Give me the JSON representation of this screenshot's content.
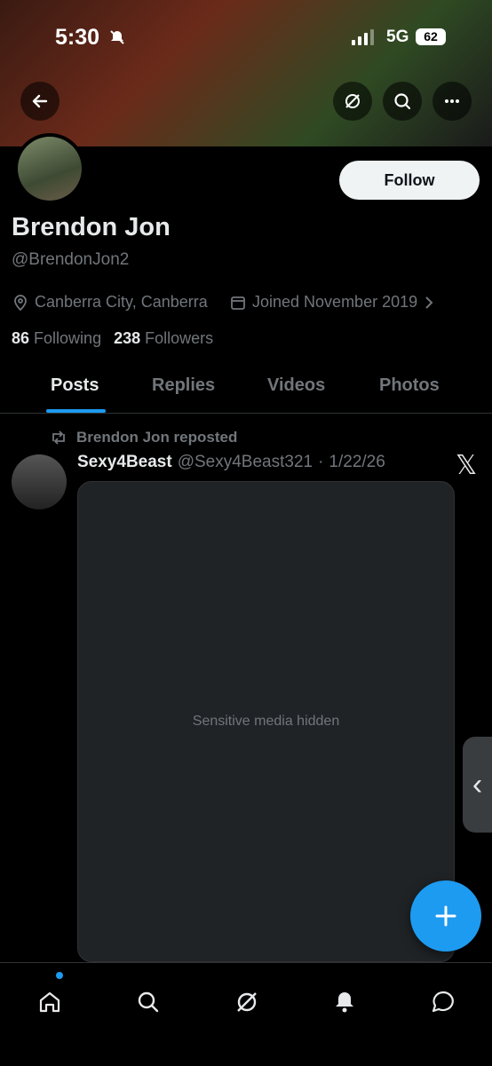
{
  "status_bar": {
    "time": "5:30",
    "network": "5G",
    "battery": "62"
  },
  "profile": {
    "name": "Brendon Jon",
    "handle": "@BrendonJon2",
    "location": "Canberra City, Canberra",
    "joined": "Joined November 2019",
    "following_count": "86",
    "following_label": "Following",
    "followers_count": "238",
    "followers_label": "Followers",
    "follow_label": "Follow"
  },
  "tabs": [
    "Posts",
    "Replies",
    "Videos",
    "Photos"
  ],
  "post": {
    "repost_label": "Brendon Jon reposted",
    "author_name": "Sexy4Beast",
    "author_handle": "@Sexy4Beast321",
    "date": "1/22/26",
    "media_note": "Sensitive media hidden"
  },
  "colors": {
    "accent": "#1d9bf0",
    "background": "#000000",
    "secondary_text": "#71767b"
  }
}
